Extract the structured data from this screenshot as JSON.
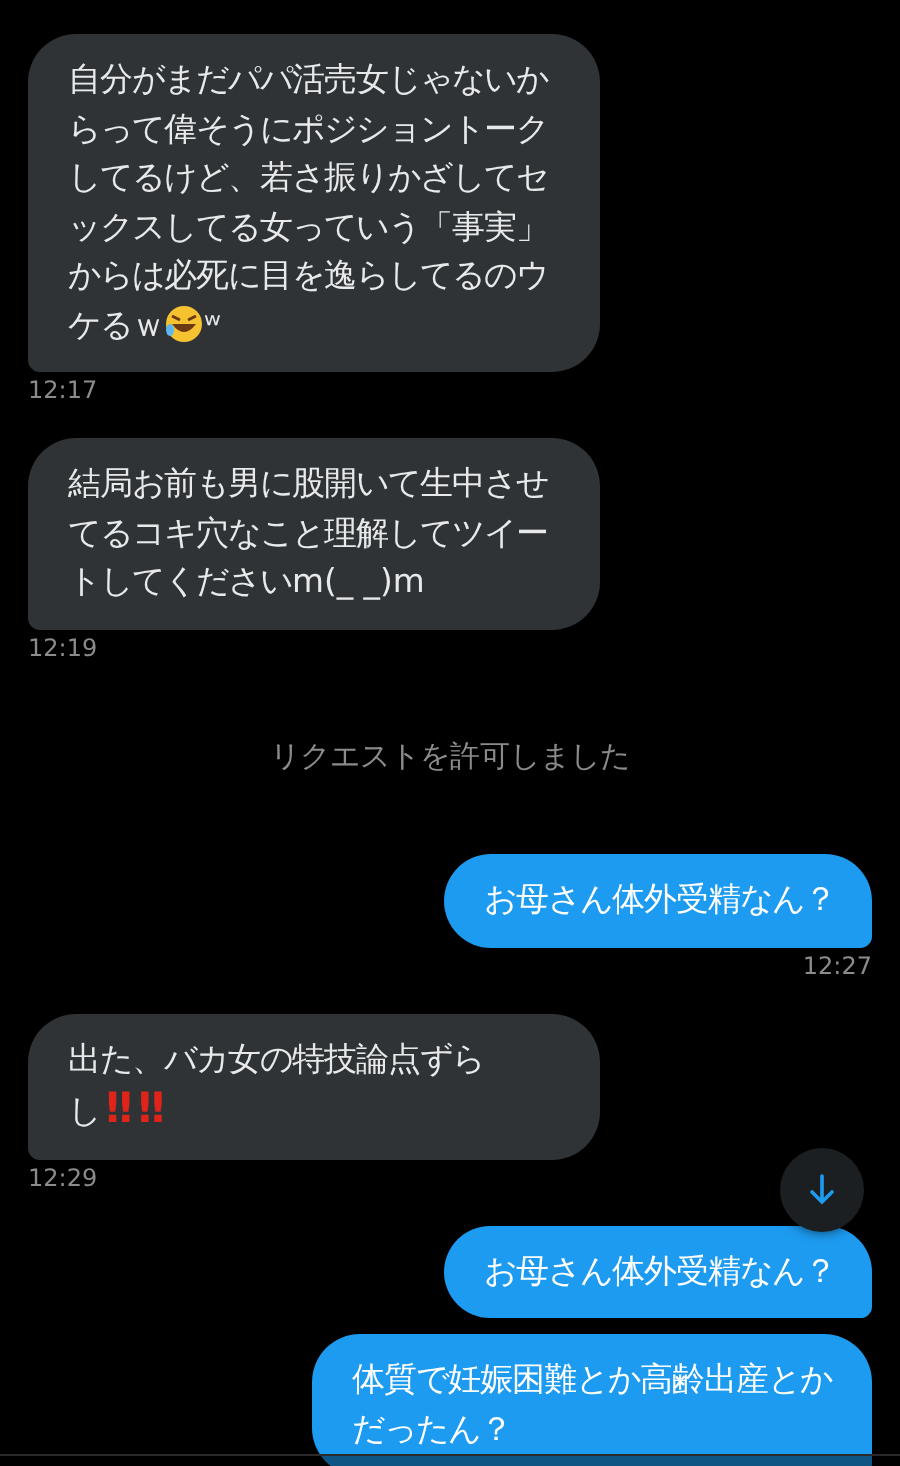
{
  "messages": [
    {
      "kind": "received",
      "parts": [
        {
          "kind": "text",
          "text": "自分がまだパパ活売女じゃないからって偉そうにポジショントークしてるけど、若さ振りかざしてセックスしてる女っていう「事実」からは必死に目を逸らしてるのウケるｗ"
        },
        {
          "kind": "emoji"
        },
        {
          "kind": "text",
          "text": "ʷ"
        }
      ],
      "time": "12:17"
    },
    {
      "kind": "received",
      "parts": [
        {
          "kind": "text",
          "text": "結局お前も男に股開いて生中させてるコキ穴なこと理解してツイートしてくださいm(_ _)m"
        }
      ],
      "time": "12:19"
    },
    {
      "kind": "system",
      "text": "リクエストを許可しました"
    },
    {
      "kind": "sent",
      "parts": [
        {
          "kind": "text",
          "text": "お母さん体外受精なん？"
        }
      ],
      "time": "12:27"
    },
    {
      "kind": "received",
      "parts": [
        {
          "kind": "text",
          "text": "出た、バカ女の特技論点ずらし"
        },
        {
          "kind": "alert",
          "text": "‼‼"
        }
      ],
      "time": "12:29"
    },
    {
      "kind": "sent",
      "parts": [
        {
          "kind": "text",
          "text": "お母さん体外受精なん？"
        }
      ]
    },
    {
      "kind": "sent",
      "parts": [
        {
          "kind": "text",
          "text": "体質で妊娠困難とか高齢出産とかだったん？"
        }
      ]
    }
  ]
}
